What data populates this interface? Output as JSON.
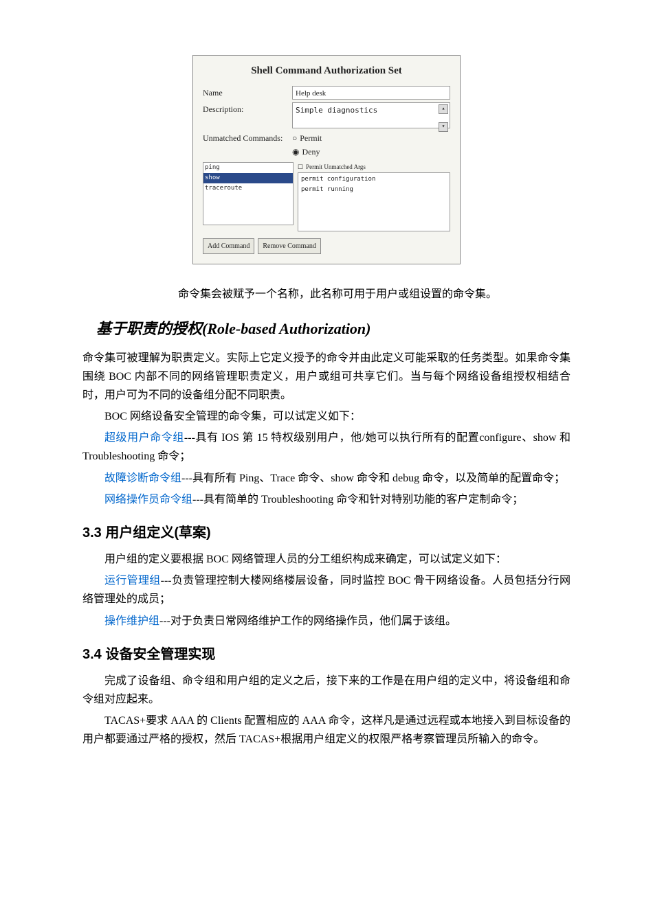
{
  "figure": {
    "title": "Shell Command Authorization Set",
    "labels": {
      "name": "Name",
      "description": "Description:",
      "unmatched": "Unmatched Commands:"
    },
    "name_value": "Help desk",
    "description_value": "Simple diagnostics",
    "radio": {
      "permit": "Permit",
      "deny": "Deny"
    },
    "permit_unmatched_args": "Permit Unmatched Args",
    "commands": {
      "ping": "ping",
      "show": "show",
      "traceroute": "traceroute"
    },
    "args": {
      "line1": "permit configuration",
      "line2": "permit running"
    },
    "buttons": {
      "add": "Add Command",
      "remove": "Remove Command"
    }
  },
  "caption": "命令集会被赋予一个名称，此名称可用于用户或组设置的命令集。",
  "h_role": "基于职责的授权(Role-based Authorization)",
  "role_p1": "命令集可被理解为职责定义。实际上它定义授予的命令并由此定义可能采取的任务类型。如果命令集围绕 BOC 内部不同的网络管理职责定义，用户或组可共享它们。当与每个网络设备组授权相结合时，用户可为不同的设备组分配不同职责。",
  "role_p2": "BOC 网络设备安全管理的命令集，可以试定义如下：",
  "role_items": {
    "super": {
      "name": "超级用户命令组",
      "desc": "---具有 IOS 第 15 特权级别用户，他/她可以执行所有的配置configure、show 和 Troubleshooting 命令；"
    },
    "diag": {
      "name": "故障诊断命令组",
      "desc": "---具有所有 Ping、Trace 命令、show 命令和 debug 命令，以及简单的配置命令；"
    },
    "oper": {
      "name": "网络操作员命令组",
      "desc": "---具有简单的 Troubleshooting 命令和针对特别功能的客户定制命令；"
    }
  },
  "h33": "3.3  用户组定义(草案)",
  "p33_intro": "用户组的定义要根据 BOC 网络管理人员的分工组织构成来确定，可以试定义如下：",
  "groups": {
    "run": {
      "name": "运行管理组",
      "desc": "---负责管理控制大楼网络楼层设备，同时监控 BOC 骨干网络设备。人员包括分行网络管理处的成员；"
    },
    "maint": {
      "name": "操作维护组",
      "desc": "---对于负责日常网络维护工作的网络操作员，他们属于该组。"
    }
  },
  "h34": "3.4  设备安全管理实现",
  "p34_1": "完成了设备组、命令组和用户组的定义之后，接下来的工作是在用户组的定义中，将设备组和命令组对应起来。",
  "p34_2": "TACAS+要求 AAA 的 Clients 配置相应的 AAA 命令，这样凡是通过远程或本地接入到目标设备的用户都要通过严格的授权，然后 TACAS+根据用户组定义的权限严格考察管理员所输入的命令。"
}
